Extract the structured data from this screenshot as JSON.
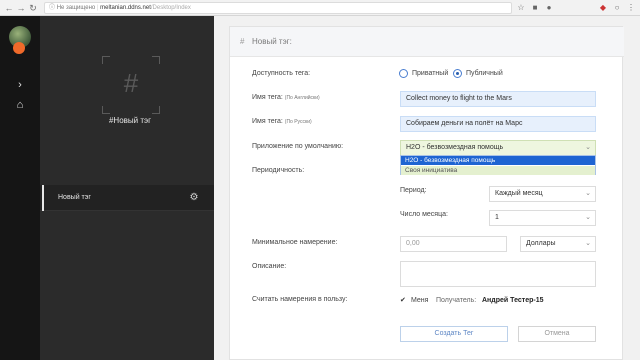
{
  "browser": {
    "security": "Не защищено",
    "host": "meltanian.ddns.net",
    "path": "/Desktop/Index",
    "back_icon": "arrow-left-icon",
    "forward_icon": "arrow-right-icon",
    "reload_icon": "reload-icon"
  },
  "rail": {
    "icons": [
      "chevron-right-icon",
      "home-icon"
    ]
  },
  "panel": {
    "tag_title": "#Новый тэг",
    "hash_glyph": "#",
    "items": [
      {
        "label": "Новый тэг",
        "icon": "gear-icon"
      }
    ]
  },
  "form": {
    "header_hash": "#",
    "header_title": "Новый тэг:",
    "availability_label": "Доступность тега:",
    "radio_private": "Приватный",
    "radio_public": "Публичный",
    "selected_visibility": "Публичный",
    "name_en_label": "Имя тега:",
    "name_en_hint": "(По Английски)",
    "name_en_value": "Collect money to flight to the Mars",
    "name_ru_label": "Имя тега:",
    "name_ru_hint": "(По Русски)",
    "name_ru_value": "Собираем деньги на полёт на Марс",
    "app_label": "Приложение по умолчанию:",
    "app_value": "H2O - безвозмездная помощь",
    "app_options": [
      "H2O - безвозмездная помощь",
      "Своя инициатива"
    ],
    "periodicity_label": "Периодичность:",
    "period_label": "Период:",
    "period_value": "Каждый месяц",
    "day_label": "Число месяца:",
    "day_value": "1",
    "min_intent_label": "Минимальное намерение:",
    "min_intent_placeholder": "0,00",
    "currency_value": "Доллары",
    "description_label": "Описание:",
    "count_for_label": "Считать намерения в пользу:",
    "me_label": "Меня",
    "recipient_label": "Получатель:",
    "recipient_value": "Андрей Тестер-15",
    "create_button": "Создать Тег",
    "cancel_button": "Отмена"
  },
  "colors": {
    "rail_bg": "#151515",
    "panel_bg": "#2b2b2b",
    "field_bg": "#e7f0fc",
    "dropdown_selected": "#1e64d2",
    "dropdown_other": "#e4f0cf",
    "avatar_dot": "#f06a2a"
  }
}
